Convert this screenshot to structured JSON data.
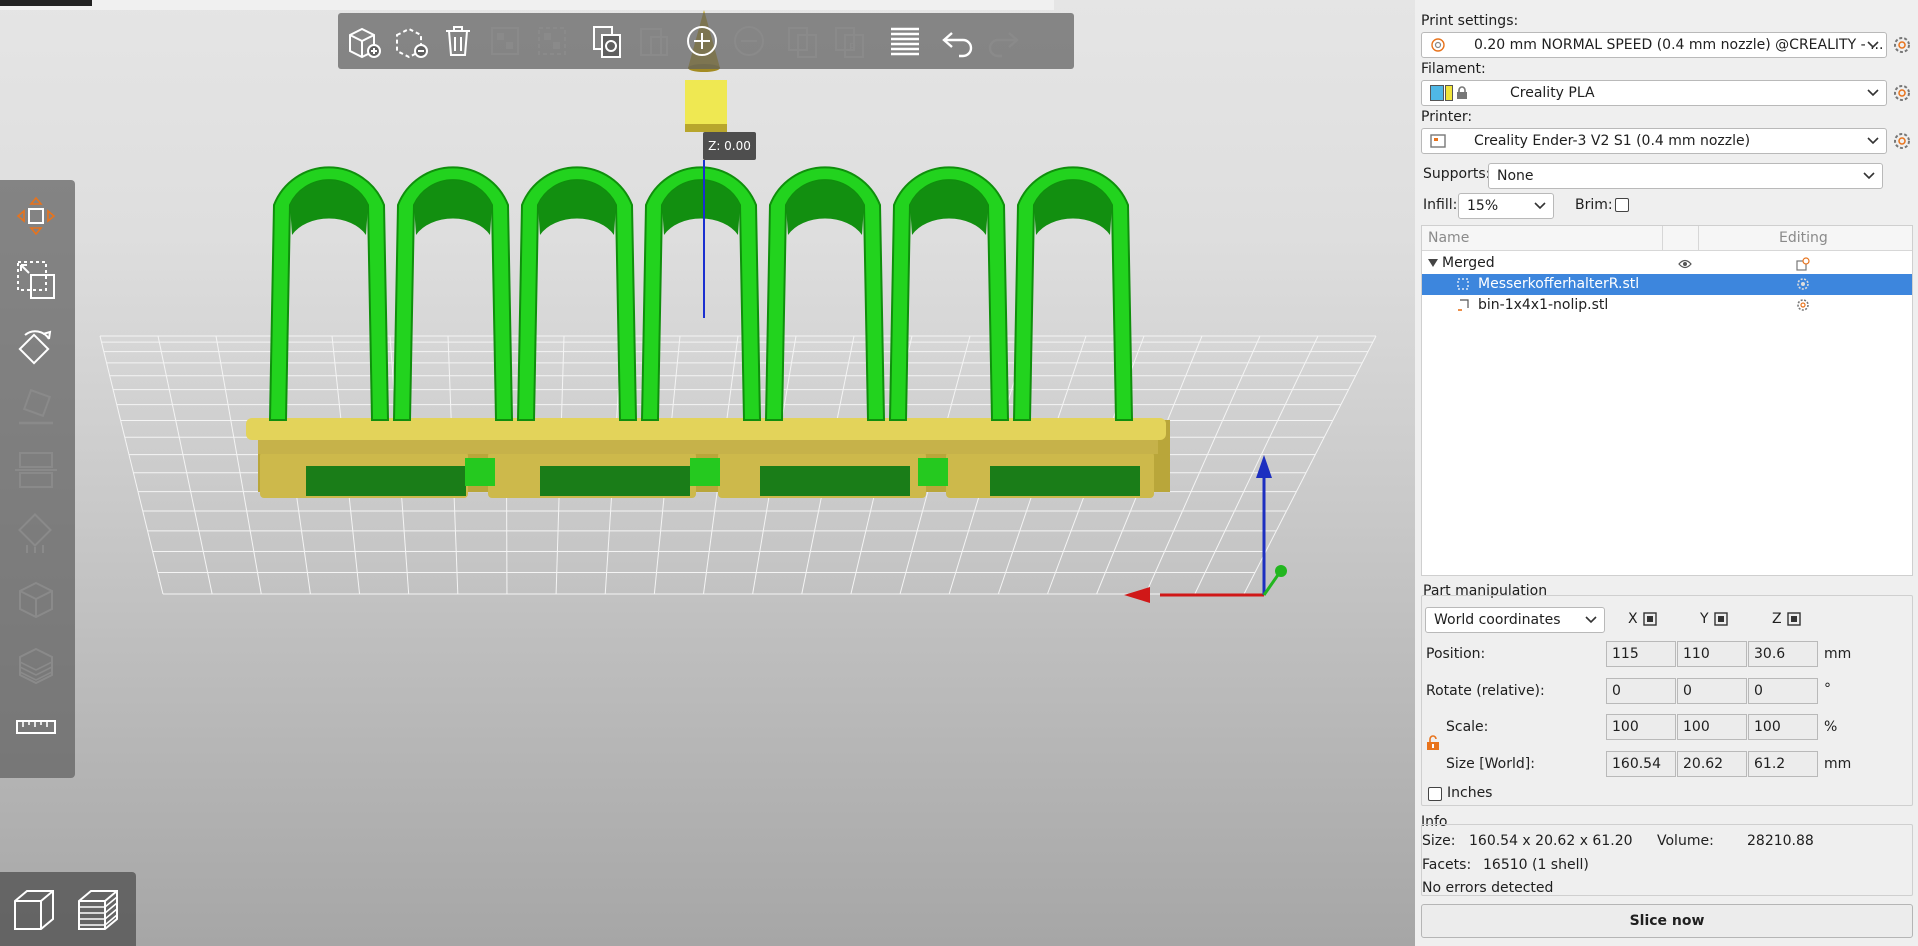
{
  "viewport": {
    "z_tooltip": "Z: 0.00"
  },
  "toolbar": {
    "items": [
      "add",
      "delete",
      "delete-all",
      "arrange",
      "arrange-selection",
      "copy",
      "paste",
      "add-instance",
      "remove-instance",
      "split-objects",
      "split-parts",
      "layers-editing",
      "undo",
      "redo"
    ]
  },
  "left_tools": [
    "move",
    "scale",
    "rotate",
    "place-on-face",
    "cut",
    "support-painting",
    "seam-painting",
    "mmu-painting",
    "measure"
  ],
  "view_modes": [
    "3d-view",
    "preview"
  ],
  "panel": {
    "print_settings_label": "Print settings:",
    "print_settings_value": "0.20 mm NORMAL SPEED (0.4 mm nozzle) @CREALITY - ...",
    "filament_label": "Filament:",
    "filament_value": "Creality PLA",
    "printer_label": "Printer:",
    "printer_value": "Creality Ender-3 V2 S1 (0.4 mm nozzle)",
    "supports_label": "Supports:",
    "supports_value": "None",
    "infill_label": "Infill:",
    "infill_value": "15%",
    "brim_label": "Brim:",
    "tree": {
      "col_name": "Name",
      "col_editing": "Editing",
      "rows": [
        {
          "label": "Merged"
        },
        {
          "label": "MesserkofferhalterR.stl"
        },
        {
          "label": "bin-1x4x1-nolip.stl"
        }
      ]
    },
    "part_manipulation": {
      "title": "Part manipulation",
      "coord_select": "World coordinates",
      "axis_x": "X",
      "axis_y": "Y",
      "axis_z": "Z",
      "position_label": "Position:",
      "position": [
        "115",
        "110",
        "30.6"
      ],
      "position_unit": "mm",
      "rotate_label": "Rotate (relative):",
      "rotate": [
        "0",
        "0",
        "0"
      ],
      "rotate_unit": "°",
      "scale_label": "Scale:",
      "scale": [
        "100",
        "100",
        "100"
      ],
      "scale_unit": "%",
      "size_label": "Size [World]:",
      "size": [
        "160.54",
        "20.62",
        "61.2"
      ],
      "size_unit": "mm",
      "inches_label": "Inches"
    },
    "info": {
      "title": "Info",
      "size_label": "Size:",
      "size_value": "160.54 x 20.62 x 61.20",
      "volume_label": "Volume:",
      "volume_value": "28210.88",
      "facets_label": "Facets:",
      "facets_value": "16510 (1 shell)",
      "status": "No errors detected"
    },
    "slice_button": "Slice now"
  },
  "colors": {
    "selection": "#3d86dd",
    "model_green": "#22d31e",
    "model_yellow": "#d8c84a",
    "accent_orange": "#e8731c"
  }
}
